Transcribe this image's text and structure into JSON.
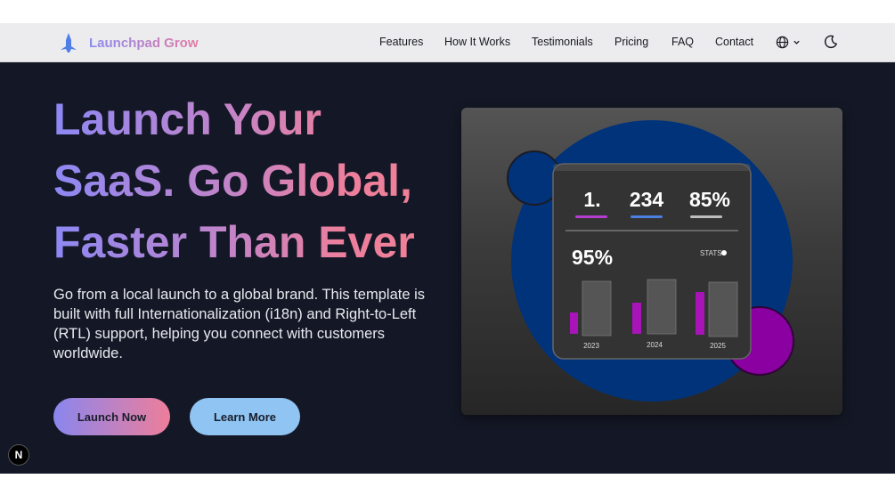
{
  "nav": {
    "brand": "Launchpad Grow",
    "links": [
      "Features",
      "How It Works",
      "Testimonials",
      "Pricing",
      "FAQ",
      "Contact"
    ]
  },
  "hero": {
    "headline": [
      "Launch Your",
      "SaaS. Go Global,",
      "Faster Than Ever"
    ],
    "subtitle": "Go from a local launch to a global brand. This template is built with full Internationalization (i18n) and Right-to-Left (RTL) support, helping you connect with customers worldwide.",
    "primary_cta": "Launch Now",
    "secondary_cta": "Learn More"
  },
  "dashboard": {
    "stats": [
      "1.",
      "234",
      "85%"
    ],
    "big_value": "95%",
    "stats_label": "STATS",
    "years": [
      "2023",
      "2024",
      "2025"
    ]
  },
  "dev_badge": "N",
  "colors": {
    "hero_bg": "#141826",
    "navbar_bg": "#ececee",
    "accent_purple": "#8d88f4",
    "accent_pink": "#ee7e9a",
    "secondary_button": "#8fc4f3",
    "bar_magenta": "#a814b8"
  }
}
